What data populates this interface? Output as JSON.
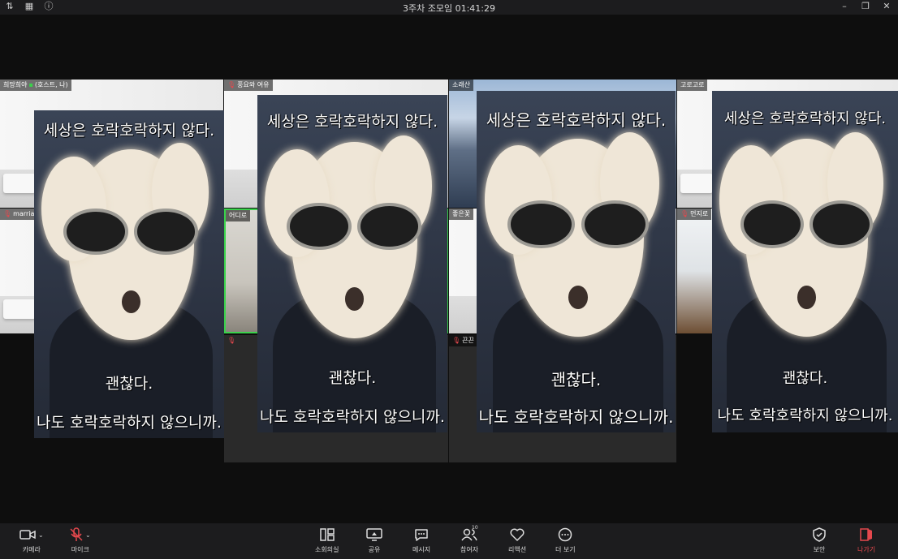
{
  "window": {
    "title": "3주차 조모임 01:41:29",
    "left_icons": [
      "sort-icon",
      "grid-icon",
      "info-icon"
    ],
    "right_icons": [
      "minimize-icon",
      "restore-icon",
      "close-icon"
    ]
  },
  "participants": [
    {
      "name": "희망희야",
      "suffix": "(호스트, 나)"
    },
    {
      "name": "풍요와 여유"
    },
    {
      "name": "소래산"
    },
    {
      "name": "고로고로"
    },
    {
      "name": "marria"
    },
    {
      "name": "어디로"
    },
    {
      "name": "좋은꽃"
    },
    {
      "name": "먼지로"
    },
    {
      "name": ""
    },
    {
      "name": "끈끈"
    }
  ],
  "meme": {
    "top_text": "세상은 호락호락하지 않다.",
    "mid_text": "괜찮다.",
    "bottom_text": "나도 호락호락하지 않으니까."
  },
  "toolbar": {
    "camera": "카메라",
    "mic": "마이크",
    "breakout": "소회의실",
    "share": "공유",
    "chat": "메시지",
    "participants": "참여자",
    "participants_count": "10",
    "reactions": "리액션",
    "more": "더 보기",
    "security": "보안",
    "leave": "나가기"
  },
  "colors": {
    "muted_red": "#e5484d",
    "active_speaker_green": "#3ad14b",
    "toolbar_bg": "#1c1c1e"
  }
}
